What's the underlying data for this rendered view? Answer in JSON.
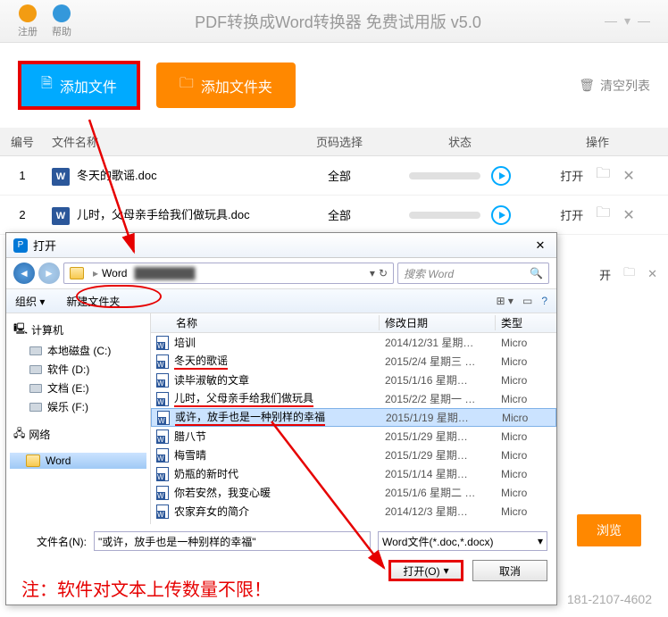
{
  "header": {
    "register": "注册",
    "help": "帮助",
    "title": "PDF转换成Word转换器 免费试用版 v5.0"
  },
  "toolbar": {
    "add_file": "添加文件",
    "add_folder": "添加文件夹",
    "clear_list": "清空列表"
  },
  "table": {
    "head": {
      "idx": "编号",
      "name": "文件名称",
      "page": "页码选择",
      "status": "状态",
      "ops": "操作"
    },
    "op_open": "打开",
    "rows": [
      {
        "idx": "1",
        "name": "冬天的歌谣.doc",
        "page": "全部"
      },
      {
        "idx": "2",
        "name": "儿时，父母亲手给我们做玩具.doc",
        "page": "全部"
      }
    ]
  },
  "behind": {
    "op_open_label": "开"
  },
  "dialog": {
    "title": "打开",
    "breadcrumb_word": "Word",
    "search_placeholder": "搜索 Word",
    "organize": "组织",
    "new_folder": "新建文件夹",
    "sidebar": {
      "computer": "计算机",
      "drives": [
        "本地磁盘 (C:)",
        "软件 (D:)",
        "文档 (E:)",
        "娱乐 (F:)"
      ],
      "network": "网络",
      "word": "Word"
    },
    "cols": {
      "name": "名称",
      "date": "修改日期",
      "type": "类型"
    },
    "files": [
      {
        "name": "培训",
        "date": "2014/12/31 星期…",
        "type": "Micro"
      },
      {
        "name": "冬天的歌谣",
        "date": "2015/2/4 星期三 …",
        "type": "Micro",
        "underline": true
      },
      {
        "name": "读毕淑敏的文章",
        "date": "2015/1/16 星期…",
        "type": "Micro"
      },
      {
        "name": "儿时，父母亲手给我们做玩具",
        "date": "2015/2/2 星期一 …",
        "type": "Micro",
        "underline": true
      },
      {
        "name": "或许，放手也是一种别样的幸福",
        "date": "2015/1/19 星期…",
        "type": "Micro",
        "selected": true,
        "underline": true
      },
      {
        "name": "腊八节",
        "date": "2015/1/29 星期…",
        "type": "Micro"
      },
      {
        "name": "梅雪晴",
        "date": "2015/1/29 星期…",
        "type": "Micro"
      },
      {
        "name": "奶瓶的新时代",
        "date": "2015/1/14 星期…",
        "type": "Micro"
      },
      {
        "name": "你若安然，我变心暖",
        "date": "2015/1/6 星期二 …",
        "type": "Micro"
      },
      {
        "name": "农家弃女的简介",
        "date": "2014/12/3 星期…",
        "type": "Micro"
      }
    ],
    "filename_label": "文件名(N):",
    "filename_value": "\"或许，放手也是一种别样的幸福\"",
    "filetype": "Word文件(*.doc,*.docx)",
    "open_btn": "打开(O)",
    "cancel_btn": "取消"
  },
  "note": "注：软件对文本上传数量不限！",
  "browse": "浏览",
  "phone": "181-2107-4602"
}
